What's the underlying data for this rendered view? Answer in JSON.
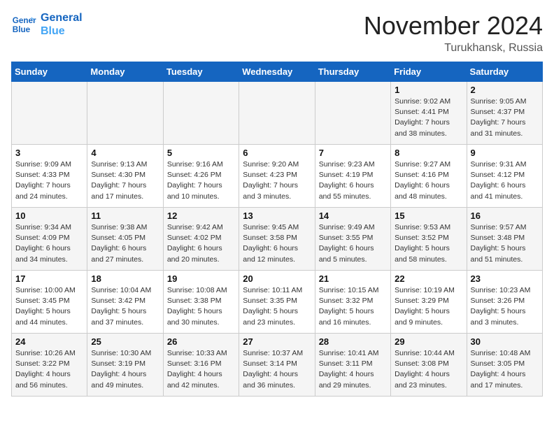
{
  "header": {
    "logo_line1": "General",
    "logo_line2": "Blue",
    "month": "November 2024",
    "location": "Turukhansk, Russia"
  },
  "days_of_week": [
    "Sunday",
    "Monday",
    "Tuesday",
    "Wednesday",
    "Thursday",
    "Friday",
    "Saturday"
  ],
  "weeks": [
    [
      {
        "day": "",
        "info": ""
      },
      {
        "day": "",
        "info": ""
      },
      {
        "day": "",
        "info": ""
      },
      {
        "day": "",
        "info": ""
      },
      {
        "day": "",
        "info": ""
      },
      {
        "day": "1",
        "info": "Sunrise: 9:02 AM\nSunset: 4:41 PM\nDaylight: 7 hours\nand 38 minutes."
      },
      {
        "day": "2",
        "info": "Sunrise: 9:05 AM\nSunset: 4:37 PM\nDaylight: 7 hours\nand 31 minutes."
      }
    ],
    [
      {
        "day": "3",
        "info": "Sunrise: 9:09 AM\nSunset: 4:33 PM\nDaylight: 7 hours\nand 24 minutes."
      },
      {
        "day": "4",
        "info": "Sunrise: 9:13 AM\nSunset: 4:30 PM\nDaylight: 7 hours\nand 17 minutes."
      },
      {
        "day": "5",
        "info": "Sunrise: 9:16 AM\nSunset: 4:26 PM\nDaylight: 7 hours\nand 10 minutes."
      },
      {
        "day": "6",
        "info": "Sunrise: 9:20 AM\nSunset: 4:23 PM\nDaylight: 7 hours\nand 3 minutes."
      },
      {
        "day": "7",
        "info": "Sunrise: 9:23 AM\nSunset: 4:19 PM\nDaylight: 6 hours\nand 55 minutes."
      },
      {
        "day": "8",
        "info": "Sunrise: 9:27 AM\nSunset: 4:16 PM\nDaylight: 6 hours\nand 48 minutes."
      },
      {
        "day": "9",
        "info": "Sunrise: 9:31 AM\nSunset: 4:12 PM\nDaylight: 6 hours\nand 41 minutes."
      }
    ],
    [
      {
        "day": "10",
        "info": "Sunrise: 9:34 AM\nSunset: 4:09 PM\nDaylight: 6 hours\nand 34 minutes."
      },
      {
        "day": "11",
        "info": "Sunrise: 9:38 AM\nSunset: 4:05 PM\nDaylight: 6 hours\nand 27 minutes."
      },
      {
        "day": "12",
        "info": "Sunrise: 9:42 AM\nSunset: 4:02 PM\nDaylight: 6 hours\nand 20 minutes."
      },
      {
        "day": "13",
        "info": "Sunrise: 9:45 AM\nSunset: 3:58 PM\nDaylight: 6 hours\nand 12 minutes."
      },
      {
        "day": "14",
        "info": "Sunrise: 9:49 AM\nSunset: 3:55 PM\nDaylight: 6 hours\nand 5 minutes."
      },
      {
        "day": "15",
        "info": "Sunrise: 9:53 AM\nSunset: 3:52 PM\nDaylight: 5 hours\nand 58 minutes."
      },
      {
        "day": "16",
        "info": "Sunrise: 9:57 AM\nSunset: 3:48 PM\nDaylight: 5 hours\nand 51 minutes."
      }
    ],
    [
      {
        "day": "17",
        "info": "Sunrise: 10:00 AM\nSunset: 3:45 PM\nDaylight: 5 hours\nand 44 minutes."
      },
      {
        "day": "18",
        "info": "Sunrise: 10:04 AM\nSunset: 3:42 PM\nDaylight: 5 hours\nand 37 minutes."
      },
      {
        "day": "19",
        "info": "Sunrise: 10:08 AM\nSunset: 3:38 PM\nDaylight: 5 hours\nand 30 minutes."
      },
      {
        "day": "20",
        "info": "Sunrise: 10:11 AM\nSunset: 3:35 PM\nDaylight: 5 hours\nand 23 minutes."
      },
      {
        "day": "21",
        "info": "Sunrise: 10:15 AM\nSunset: 3:32 PM\nDaylight: 5 hours\nand 16 minutes."
      },
      {
        "day": "22",
        "info": "Sunrise: 10:19 AM\nSunset: 3:29 PM\nDaylight: 5 hours\nand 9 minutes."
      },
      {
        "day": "23",
        "info": "Sunrise: 10:23 AM\nSunset: 3:26 PM\nDaylight: 5 hours\nand 3 minutes."
      }
    ],
    [
      {
        "day": "24",
        "info": "Sunrise: 10:26 AM\nSunset: 3:22 PM\nDaylight: 4 hours\nand 56 minutes."
      },
      {
        "day": "25",
        "info": "Sunrise: 10:30 AM\nSunset: 3:19 PM\nDaylight: 4 hours\nand 49 minutes."
      },
      {
        "day": "26",
        "info": "Sunrise: 10:33 AM\nSunset: 3:16 PM\nDaylight: 4 hours\nand 42 minutes."
      },
      {
        "day": "27",
        "info": "Sunrise: 10:37 AM\nSunset: 3:14 PM\nDaylight: 4 hours\nand 36 minutes."
      },
      {
        "day": "28",
        "info": "Sunrise: 10:41 AM\nSunset: 3:11 PM\nDaylight: 4 hours\nand 29 minutes."
      },
      {
        "day": "29",
        "info": "Sunrise: 10:44 AM\nSunset: 3:08 PM\nDaylight: 4 hours\nand 23 minutes."
      },
      {
        "day": "30",
        "info": "Sunrise: 10:48 AM\nSunset: 3:05 PM\nDaylight: 4 hours\nand 17 minutes."
      }
    ]
  ]
}
